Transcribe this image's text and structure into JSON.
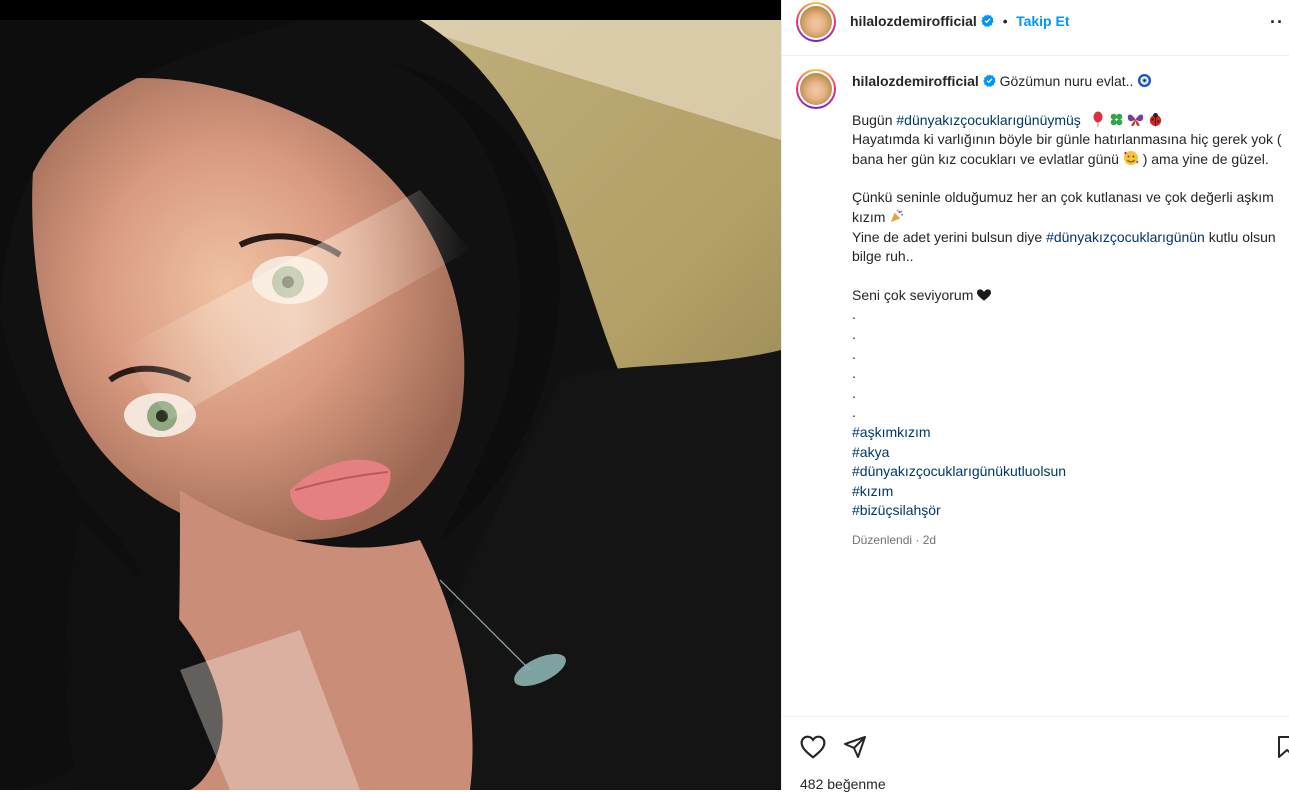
{
  "post": {
    "username": "hilalozdemirofficial",
    "follow_label": "Takip Et",
    "dot": "•",
    "more_label": "··",
    "caption_first": "Gözümun nuru evlat..",
    "line1_prefix": "Bugün ",
    "line1_tag": "#dünyakızçocuklarıgünüymüş",
    "line2": "Hayatımda ki varlığının böyle bir günle hatırlanmasına hiç gerek yok ( bana her gün kız cocukları ve evlatlar günü",
    "line2_end": " ) ama yine de güzel.",
    "para2a": "Çünkü seninle olduğumuz her an çok kutlanası ve çok değerli aşkım kızım",
    "para2b_prefix": "Yine de adet yerini bulsun diye ",
    "para2b_tag": "#dünyakızçocuklarıgünün",
    "para2b_suffix": " kutlu olsun bilge ruh..",
    "love_line": "Seni çok seviyorum",
    "dots": [
      ".",
      ".",
      ".",
      ".",
      ".",
      "."
    ],
    "hashtags": [
      "#aşkımkızım",
      "#akya",
      "#dünyakızçocuklarıgünükutluolsun",
      "#kızım",
      "#bizüçsilahşör"
    ],
    "edited": "Düzenlendi",
    "meta_sep": "·",
    "time": "2d",
    "likes": "482 beğenme"
  },
  "icons": {
    "verified": "verified-badge-icon",
    "heart": "heart-icon",
    "share": "share-icon",
    "save": "bookmark-icon",
    "more": "more-icon"
  },
  "colors": {
    "link": "#0095f6",
    "hashtag": "#00376b",
    "verified": "#0095f6"
  }
}
